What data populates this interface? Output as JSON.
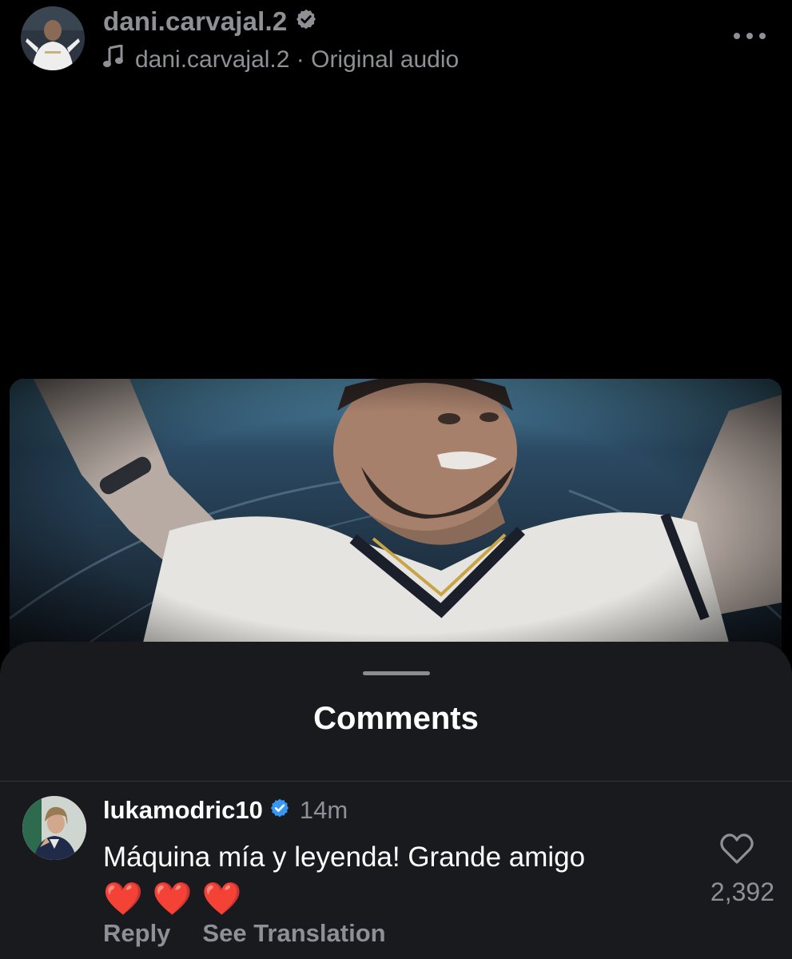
{
  "post": {
    "username": "dani.carvajal.2",
    "audio": "dani.carvajal.2 · Original audio",
    "more_icon": "more-horizontal-icon",
    "music_icon": "music-note-icon",
    "verified_icon": "verified-badge-icon"
  },
  "sheet": {
    "title": "Comments"
  },
  "comment": {
    "username": "lukamodric10",
    "time": "14m",
    "text": "Máquina mía y leyenda! Grande amigo",
    "emoji": [
      "❤️",
      "❤️",
      "❤️"
    ],
    "likes": "2,392",
    "reply_label": "Reply",
    "translation_label": "See Translation"
  },
  "colors": {
    "background": "#000000",
    "sheet": "#191a1e",
    "muted_text": "#8e9096",
    "verified_blue": "#3897f0"
  }
}
